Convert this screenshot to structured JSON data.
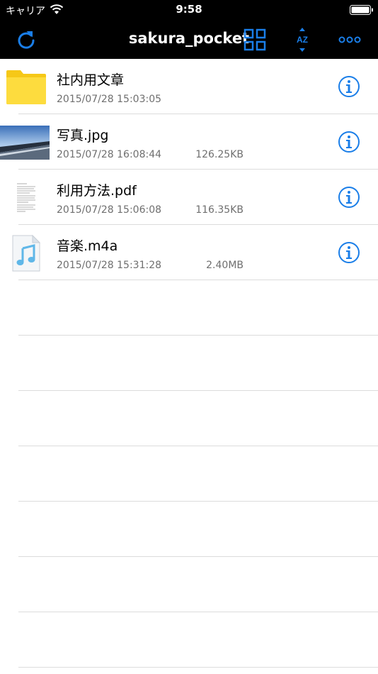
{
  "status_bar": {
    "carrier": "キャリア",
    "time": "9:58"
  },
  "nav": {
    "title": "sakura_pocket",
    "accent_color": "#1a7ee8",
    "buttons": [
      "refresh-icon",
      "grid-view-icon",
      "sort-az-icon",
      "more-icon"
    ]
  },
  "files": [
    {
      "name": "社内用文章",
      "date": "2015/07/28 15:03:05",
      "size": "",
      "type": "folder"
    },
    {
      "name": "写真.jpg",
      "date": "2015/07/28 16:08:44",
      "size": "126.25KB",
      "type": "image"
    },
    {
      "name": "利用方法.pdf",
      "date": "2015/07/28 15:06:08",
      "size": "116.35KB",
      "type": "pdf"
    },
    {
      "name": "音楽.m4a",
      "date": "2015/07/28 15:31:28",
      "size": "2.40MB",
      "type": "audio"
    }
  ]
}
